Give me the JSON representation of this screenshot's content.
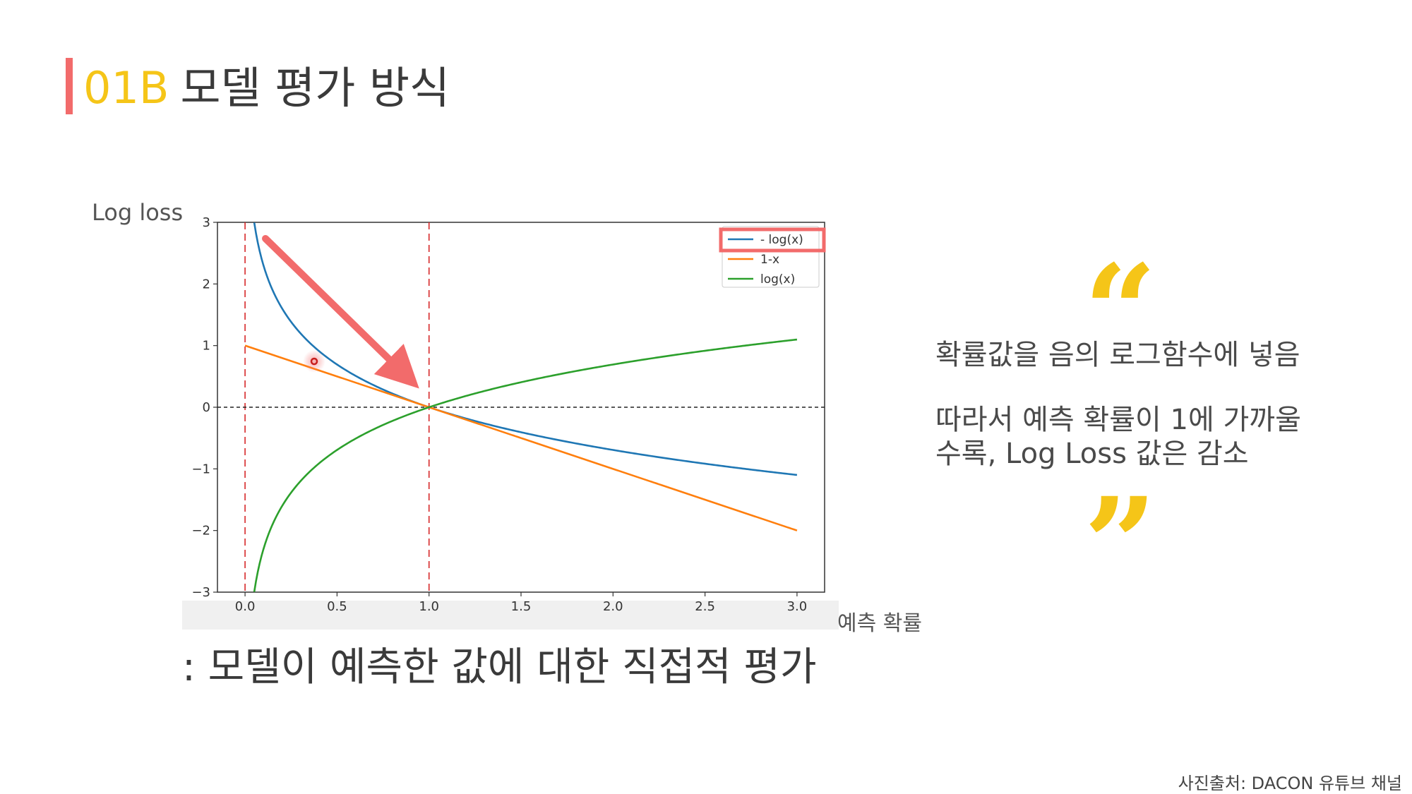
{
  "slide": {
    "number": "01B",
    "title": "모델 평가 방식",
    "y_axis_note": "Log loss",
    "x_axis_note": "예측 확률",
    "caption": ": 모델이 예측한 값에 대한 직접적 평가",
    "quote_line_1": "확률값을 음의 로그함수에 넣음",
    "quote_line_2": "따라서 예측 확률이 1에 가까울",
    "quote_line_3": "수록, Log Loss 값은 감소",
    "quote_open": "“",
    "quote_close": "”",
    "source": "사진출처: DACON 유튜브 채널"
  },
  "colors": {
    "accent": "#f26b6b",
    "highlight": "#f5c518",
    "neg_log": "#1f77b4",
    "one_minus_x": "#ff7f0e",
    "log": "#2ca02c",
    "reference_line": "#d62728"
  },
  "chart_data": {
    "type": "line",
    "xlim": [
      -0.15,
      3.15
    ],
    "ylim": [
      -3,
      3
    ],
    "xticks": [
      "0.0",
      "0.5",
      "1.0",
      "1.5",
      "2.0",
      "2.5",
      "3.0"
    ],
    "xtick_values": [
      0,
      0.5,
      1,
      1.5,
      2,
      2.5,
      3
    ],
    "yticks": [
      "−3",
      "−2",
      "−1",
      "0",
      "1",
      "2",
      "3"
    ],
    "ytick_values": [
      -3,
      -2,
      -1,
      0,
      1,
      2,
      3
    ],
    "series": [
      {
        "name": "- log(x)",
        "function": "neg_log",
        "x_range": [
          0.05,
          3
        ],
        "color": "#1f77b4"
      },
      {
        "name": "1-x",
        "function": "one_minus_x",
        "x_range": [
          0,
          3
        ],
        "color": "#ff7f0e"
      },
      {
        "name": "log(x)",
        "function": "log",
        "x_range": [
          0.05,
          3
        ],
        "color": "#2ca02c"
      }
    ],
    "vertical_lines": [
      0,
      1
    ],
    "horizontal_lines": [
      0
    ],
    "legend_position": "top-right",
    "legend_highlight": "- log(x)"
  }
}
